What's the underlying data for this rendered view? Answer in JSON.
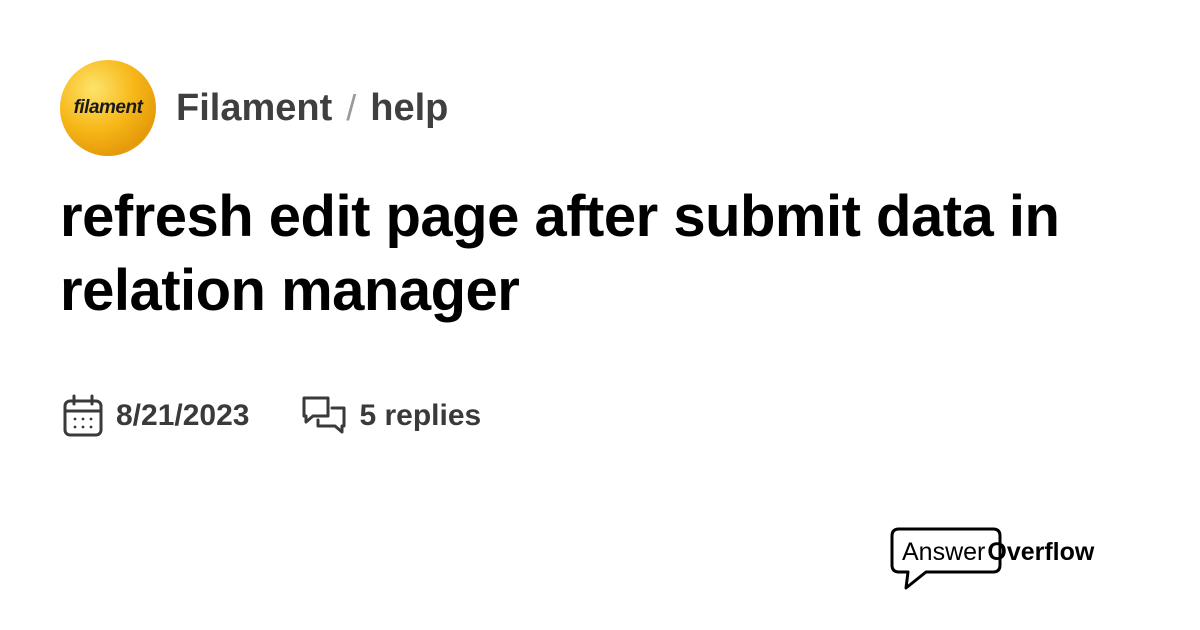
{
  "header": {
    "server_icon_text": "filament",
    "server_name": "Filament",
    "separator": "/",
    "channel_name": "help"
  },
  "thread": {
    "title": "refresh edit page after submit data in relation manager",
    "date": "8/21/2023",
    "replies": "5 replies"
  },
  "brand": {
    "answer": "Answer",
    "overflow": "Overflow"
  },
  "icons": {
    "server": "filament-logo-icon",
    "date": "calendar-icon",
    "replies": "chat-bubbles-icon",
    "brand": "speech-bubble-logo-icon"
  },
  "colors": {
    "server_icon_gold": "#f7b718",
    "breadcrumb_text": "#3f3f3f",
    "title_text": "#000000",
    "meta_text": "#3a3a3a"
  }
}
